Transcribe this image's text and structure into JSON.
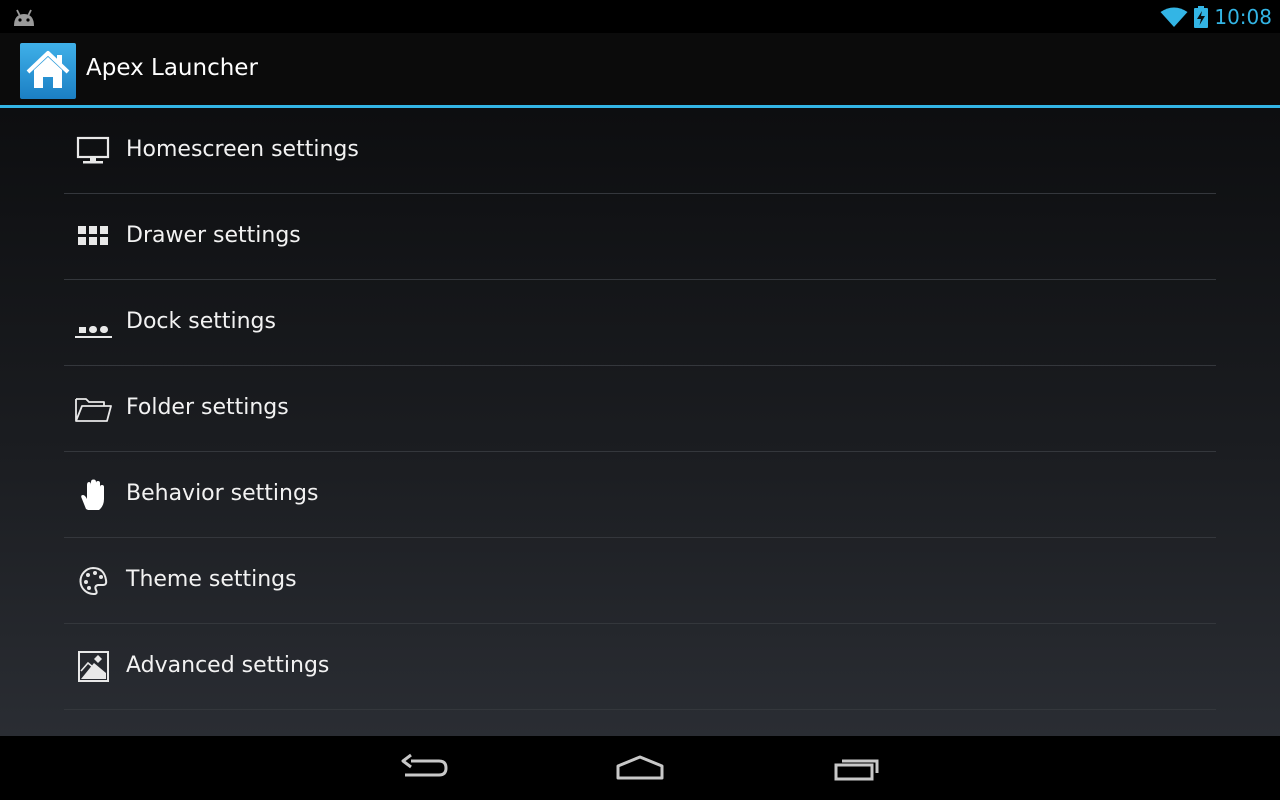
{
  "status_bar": {
    "time": "10:08",
    "accent_color": "#33b5e5",
    "left_icon": "android-debug-icon",
    "right_icons": [
      "wifi-icon",
      "battery-charging-icon"
    ]
  },
  "action_bar": {
    "app_icon": "home-icon",
    "title": "Apex Launcher",
    "divider_color": "#33b5e5"
  },
  "settings": {
    "items": [
      {
        "label": "Homescreen settings",
        "icon": "monitor-icon"
      },
      {
        "label": "Drawer settings",
        "icon": "app-grid-icon"
      },
      {
        "label": "Dock settings",
        "icon": "dock-icon"
      },
      {
        "label": "Folder settings",
        "icon": "folder-icon"
      },
      {
        "label": "Behavior settings",
        "icon": "hand-icon"
      },
      {
        "label": "Theme settings",
        "icon": "palette-icon"
      },
      {
        "label": "Advanced settings",
        "icon": "advanced-image-icon"
      }
    ]
  },
  "nav_bar": {
    "buttons": [
      "back-icon",
      "home-icon",
      "recent-apps-icon"
    ]
  }
}
